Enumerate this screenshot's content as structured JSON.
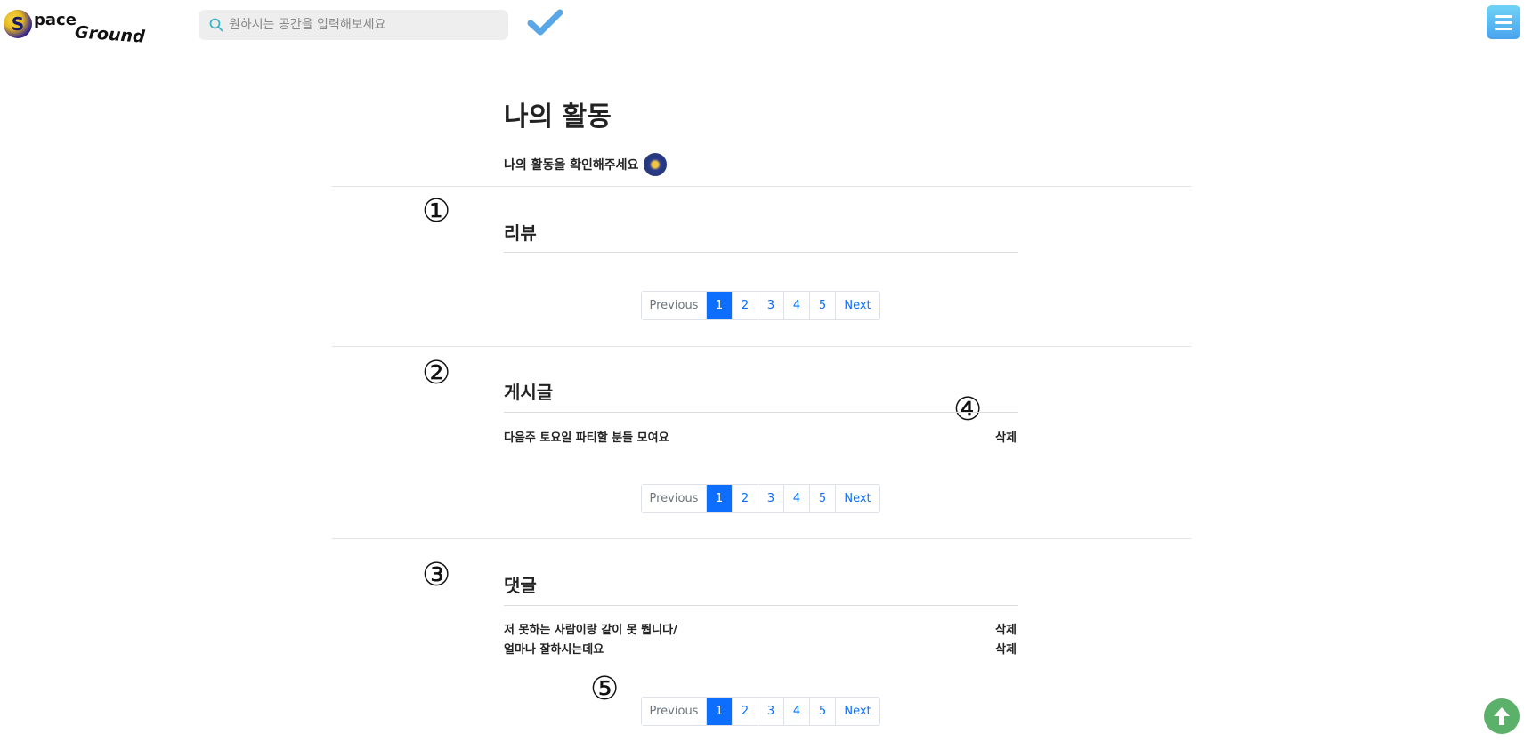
{
  "header": {
    "logo": {
      "letter": "S",
      "part1": "pace",
      "part2": "Ground"
    },
    "search": {
      "placeholder": "원하시는 공간을 입력해보세요"
    },
    "icons": {
      "search": "search-icon",
      "check": "check-icon",
      "menu": "hamburger-menu-icon"
    }
  },
  "page": {
    "title": "나의 활동",
    "subtitle": "나의 활동을 확인해주세요"
  },
  "markers": [
    "①",
    "②",
    "③",
    "④",
    "⑤"
  ],
  "sections": [
    {
      "title": "리뷰",
      "rows": []
    },
    {
      "title": "게시글",
      "rows": [
        {
          "text": "다음주 토요일 파티할 분들 모여요",
          "action": "삭제"
        }
      ]
    },
    {
      "title": "댓글",
      "rows": [
        {
          "text": "저 못하는 사람이랑 같이 못 뛉니다/",
          "action": "삭제"
        },
        {
          "text": "얼마나 잘하시는데요",
          "action": "삭제"
        }
      ]
    }
  ],
  "pagination": {
    "previous": "Previous",
    "pages": [
      "1",
      "2",
      "3",
      "4",
      "5"
    ],
    "active": "1",
    "next": "Next"
  },
  "colors": {
    "accent": "#0d6efd",
    "menu_button": "#4aa3ee",
    "scroll_top_button": "#5cb16a"
  },
  "scroll_top": {
    "icon": "arrow-up-icon"
  }
}
